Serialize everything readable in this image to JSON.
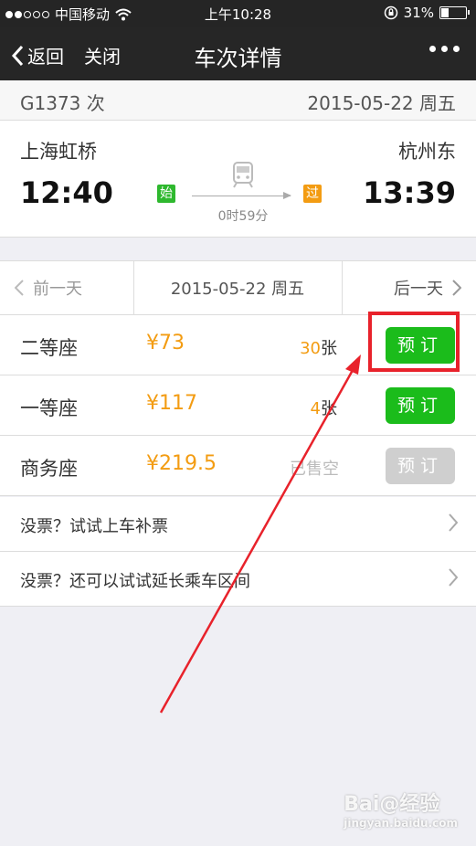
{
  "status": {
    "carrier": "中国移动",
    "time": "上午10:28",
    "battery": "31%",
    "battery_level": 0.31
  },
  "nav": {
    "back_label": "返回",
    "close_label": "关闭",
    "title": "车次详情"
  },
  "train": {
    "number": "G1373 次",
    "date": "2015-05-22 周五",
    "from": "上海虹桥",
    "to": "杭州东",
    "depart_time": "12:40",
    "arrive_time": "13:39",
    "start_tag": "始",
    "pass_tag": "过",
    "duration": "0时59分"
  },
  "day_nav": {
    "prev": "前一天",
    "current": "2015-05-22 周五",
    "next": "后一天"
  },
  "seats": [
    {
      "name": "二等座",
      "price": "¥73",
      "count": "30",
      "unit": "张",
      "book": "预订"
    },
    {
      "name": "一等座",
      "price": "¥117",
      "count": "4",
      "unit": "张",
      "book": "预订"
    },
    {
      "name": "商务座",
      "price": "¥219.5",
      "status": "已售空",
      "book": "预订"
    }
  ],
  "links": [
    {
      "label": "没票？试试上车补票"
    },
    {
      "label": "没票？还可以试试延长乘车区间"
    }
  ],
  "watermark": {
    "brand": "Bai@经验",
    "site": "jingyan.baidu.com"
  },
  "colors": {
    "accent_green": "#1bbc1b",
    "price_orange": "#f39c12",
    "highlight_red": "#e8222b"
  }
}
